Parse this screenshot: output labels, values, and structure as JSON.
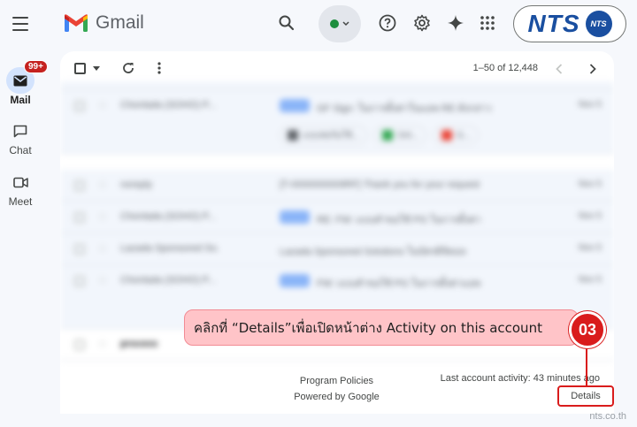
{
  "header": {
    "app_name": "Gmail",
    "brand_logo": "NTS",
    "brand_badge": "NTS",
    "icons": [
      "menu-icon",
      "search-icon",
      "status-dot",
      "help-icon",
      "settings-icon",
      "gemini-sparkle-icon",
      "apps-grid-icon"
    ]
  },
  "rail": {
    "mail_label": "Mail",
    "mail_badge": "99+",
    "chat_label": "Chat",
    "meet_label": "Meet"
  },
  "toolbar": {
    "pagination": "1–50 of 12,448"
  },
  "list": {
    "rows": [
      {
        "sender": "Chonlada (SOHO) P...",
        "subject": "GF Sign: ในการตั้งค่าในแอพ RE ดังกล่าว",
        "date": "Nov 5"
      },
      {
        "sender": "noreply",
        "subject": "[T-0000000009RF] Thank you for your request",
        "date": "Nov 5"
      },
      {
        "sender": "Chonlada (SOHO) P...",
        "subject": "RE: FW: แบบคำขอใช้ PG ในการตั้งค่า",
        "date": "Nov 5"
      },
      {
        "sender": "Lazada Sponsored So.",
        "subject": "Lazada Sponsored Solutions ในบัตรดิจิตอล",
        "date": "Nov 5"
      },
      {
        "sender": "Chonlada (SOHO) P...",
        "subject": "FW: แบบคำขอใช้ PG ในการตั้งค่าแอพ",
        "date": "Nov 5"
      },
      {
        "sender": "process",
        "subject": "",
        "date": ""
      }
    ],
    "chips": [
      "แบบฟอร์มใช้...",
      "Onl...",
      "G..."
    ]
  },
  "footer": {
    "program_policies": "Program Policies",
    "powered_by": "Powered by Google",
    "last_activity": "Last account activity: 43 minutes ago",
    "details": "Details"
  },
  "annotation": {
    "instruction": "คลิกที่ “Details”เพื่อเปิดหน้าต่าง Activity on this account",
    "step_number": "03",
    "color": "#d91c1c"
  },
  "watermark": "nts.co.th",
  "colors": {
    "accent": "#1a73e8",
    "badge_red": "#c5221f",
    "brand_blue": "#1a4fa0"
  }
}
